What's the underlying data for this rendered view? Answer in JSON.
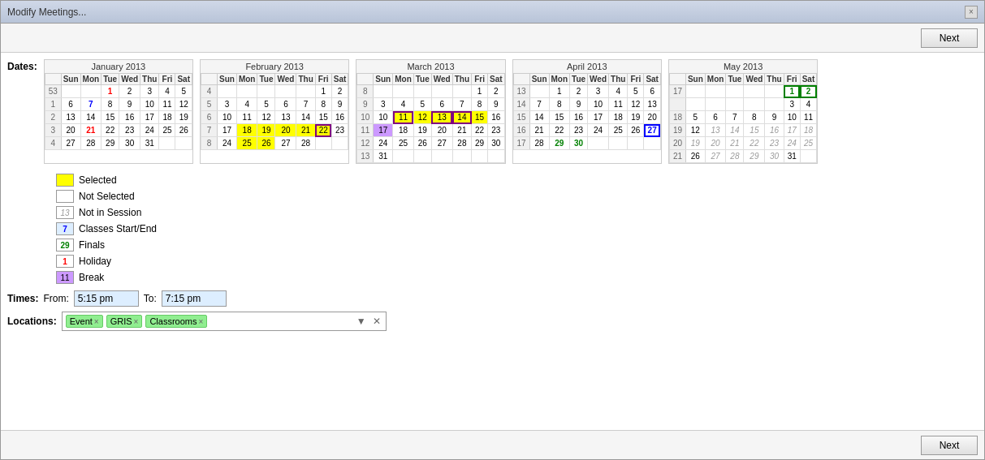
{
  "window": {
    "title": "Modify Meetings...",
    "close_icon": "×"
  },
  "toolbar": {
    "next_label": "Next"
  },
  "dates_label": "Dates:",
  "calendars": [
    {
      "title": "January 2013",
      "days": [
        "Sun",
        "Mon",
        "Tue",
        "Wed",
        "Thu",
        "Fri",
        "Sat"
      ]
    },
    {
      "title": "February 2013",
      "days": [
        "Sun",
        "Mon",
        "Tue",
        "Wed",
        "Thu",
        "Fri",
        "Sat"
      ]
    },
    {
      "title": "March 2013",
      "days": [
        "Sun",
        "Mon",
        "Tue",
        "Wed",
        "Thu",
        "Fri",
        "Sat"
      ]
    },
    {
      "title": "April 2013",
      "days": [
        "Sun",
        "Mon",
        "Tue",
        "Wed",
        "Thu",
        "Fri",
        "Sat"
      ]
    },
    {
      "title": "May 2013",
      "days": [
        "Sun",
        "Mon",
        "Tue",
        "Wed",
        "Thu",
        "Fri",
        "Sat"
      ]
    }
  ],
  "legend": {
    "selected_label": "Selected",
    "not_selected_label": "Not Selected",
    "not_in_session_label": "Not in Session",
    "classes_start_end_label": "Classes Start/End",
    "finals_label": "Finals",
    "holiday_label": "Holiday",
    "break_label": "Break",
    "classes_number": "7",
    "finals_number": "29",
    "holiday_number": "1",
    "break_number": "11",
    "not_session_number": "13"
  },
  "times": {
    "label": "Times:",
    "from_label": "From:",
    "from_value": "5:15 pm",
    "to_label": "To:",
    "to_value": "7:15 pm"
  },
  "locations": {
    "label": "Locations:",
    "tags": [
      "Event ×",
      "GRIS ×",
      "Classrooms ×"
    ],
    "tag_event": "Event",
    "tag_gris": "GRIS",
    "tag_classrooms": "Classrooms"
  },
  "bottom": {
    "next_label": "Next"
  }
}
